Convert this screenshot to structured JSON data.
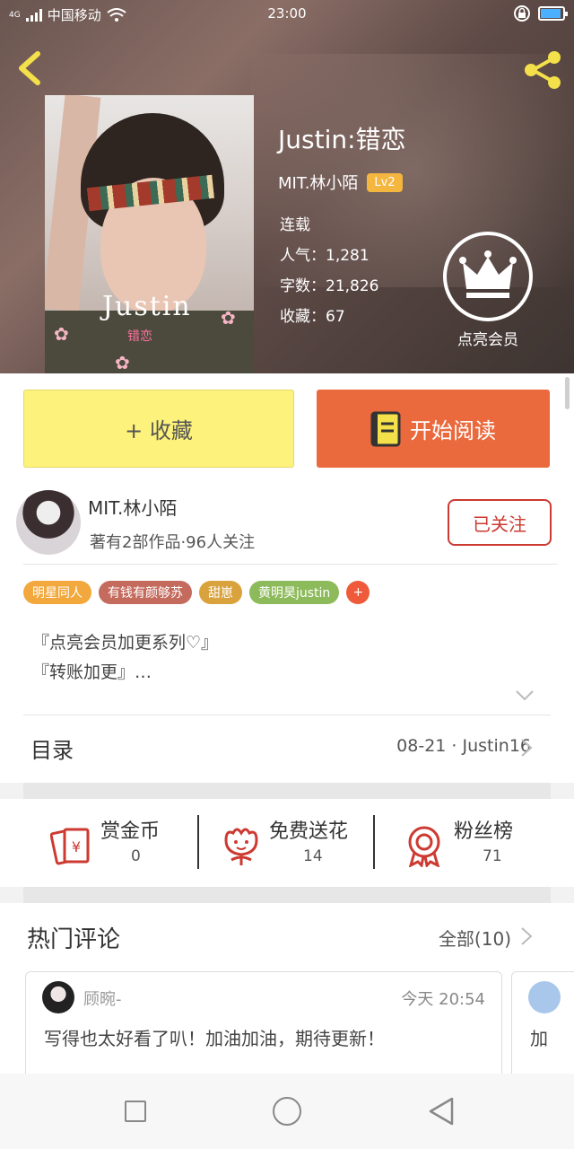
{
  "status_bar": {
    "network": "4G",
    "carrier": "中国移动",
    "time": "23:00"
  },
  "book": {
    "title": "Justin:错恋",
    "author": "MIT.林小陌",
    "level": "Lv2",
    "status": "连载",
    "popularity_label": "人气：",
    "popularity": "1,281",
    "words_label": "字数：",
    "words": "21,826",
    "favorites_label": "收藏：",
    "favorites": "67",
    "cover_title": "Justin",
    "cover_subtitle": "错恋"
  },
  "member": {
    "label": "点亮会员"
  },
  "actions": {
    "collect_label": "+ 收藏",
    "read_label": "开始阅读"
  },
  "author": {
    "name": "MIT.林小陌",
    "stats": "著有2部作品·96人关注",
    "follow_label": "已关注"
  },
  "tags": [
    {
      "label": "明星同人",
      "color": "#f2a83c"
    },
    {
      "label": "有钱有颜够苏",
      "color": "#c46b5e"
    },
    {
      "label": "甜崽",
      "color": "#d9a23c"
    },
    {
      "label": "黄明昊justin",
      "color": "#8dba5a"
    }
  ],
  "tag_add": "+",
  "description": {
    "line1": "『点亮会员加更系列♡』",
    "line2": "『转账加更』…"
  },
  "catalog": {
    "title": "目录",
    "latest": "08-21 · Justin16"
  },
  "stats": [
    {
      "label": "赏金币",
      "value": "0"
    },
    {
      "label": "免费送花",
      "value": "14"
    },
    {
      "label": "粉丝榜",
      "value": "71"
    }
  ],
  "comments": {
    "title": "热门评论",
    "all_label": "全部(10)",
    "items": [
      {
        "user": "顾晼-",
        "time": "今天 20:54",
        "text": "写得也太好看了叭！加油加油，期待更新！"
      },
      {
        "text": "加"
      }
    ]
  },
  "colors": {
    "accent_red": "#cc3a32",
    "read_button": "#ea6a3d",
    "collect_button": "#fdf27b",
    "icon_yellow": "#f4e04a"
  }
}
